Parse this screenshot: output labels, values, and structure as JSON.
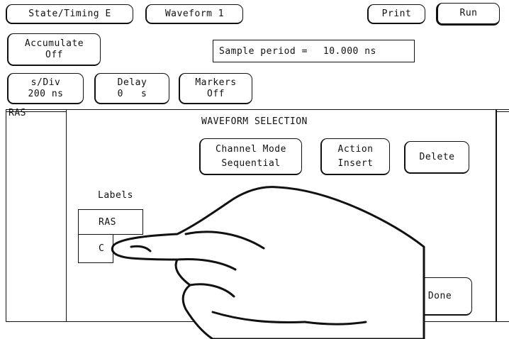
{
  "toolbar": {
    "menu1": "State/Timing E",
    "menu2": "Waveform 1",
    "print": "Print",
    "run": "Run"
  },
  "accumulate": {
    "label": "Accumulate",
    "value": "Off"
  },
  "sample_period": {
    "label": "Sample period =",
    "value": "10.000 ns"
  },
  "controls": {
    "sdiv": {
      "label": "s/Div",
      "value": "200 ns"
    },
    "delay": {
      "label": "Delay",
      "value": "0   s"
    },
    "markers": {
      "label": "Markers",
      "value": "Off"
    }
  },
  "waveform_area": {
    "channel_label": "RAS"
  },
  "dialog": {
    "title": "WAVEFORM SELECTION",
    "channel_mode": {
      "label": "Channel Mode",
      "value": "Sequential"
    },
    "action": {
      "label": "Action",
      "value": "Insert"
    },
    "delete": "Delete",
    "labels_heading": "Labels",
    "labels": [
      "RAS",
      "C"
    ],
    "done": "Done"
  },
  "overlay": {
    "icon": "pointing-hand-icon"
  }
}
